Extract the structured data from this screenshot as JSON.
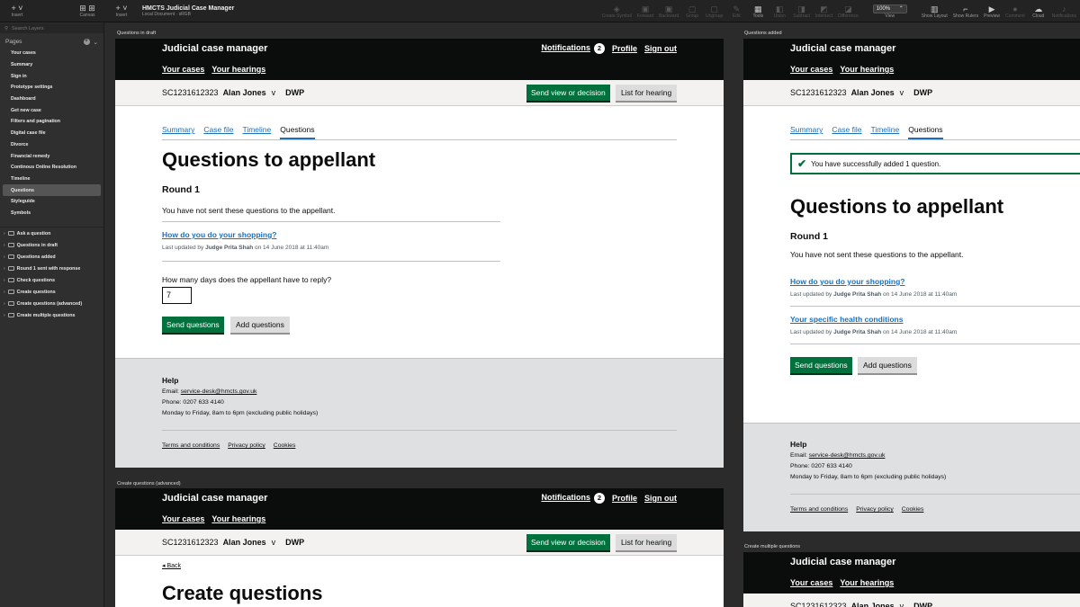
{
  "toolbar": {
    "insert": "Insert",
    "canvas": "Canvas",
    "doc_title": "HMCTS Judicial Case Manager",
    "doc_sub": "Local Document · sRGB",
    "tools": [
      "Create Symbol",
      "Forward",
      "Backward",
      "Group",
      "Ungroup",
      "Edit",
      "Tools",
      "Union",
      "Subtract",
      "Intersect",
      "Difference"
    ],
    "zoom": "100%",
    "zoom_label": "View",
    "right": [
      "Show Layout",
      "Show Rulers",
      "Preview",
      "Comment",
      "Cloud",
      "Notifications"
    ]
  },
  "sidebar": {
    "search_placeholder": "Search Layers",
    "pages_label": "Pages",
    "pages": [
      "Your cases",
      "Summary",
      "Sign in",
      "Prototype settings",
      "Dashboard",
      "Get new case",
      "Filters and pagination",
      "Digital case file",
      "Divorce",
      "Financial remedy",
      "Continous Online Resolution",
      "Timeline",
      "Questions",
      "Styleguide",
      "Symbols"
    ],
    "selected_page": "Questions",
    "layers": [
      "Ask a question",
      "Questions in draft",
      "Questions added",
      "Round 1 sent with response",
      "Check questions",
      "Create questions",
      "Create questions (advanced)",
      "Create multiple questions"
    ]
  },
  "service": {
    "name": "Judicial case manager",
    "notifications": "Notifications",
    "notif_count": "2",
    "profile": "Profile",
    "sign_out": "Sign out",
    "your_cases": "Your cases",
    "your_hearings": "Your hearings",
    "case_ref": "SC1231612323",
    "party1": "Alan Jones",
    "vs": "v",
    "party2": "DWP",
    "send_view": "Send view or decision",
    "list_hearing": "List for hearing",
    "tabs": [
      "Summary",
      "Case file",
      "Timeline",
      "Questions"
    ],
    "current_tab": "Questions"
  },
  "artboards": {
    "a1_label": "Questions in draft",
    "a2_label": "Questions added",
    "a3_label": "Create questions (advanced)",
    "a4_label": "Create multiple questions"
  },
  "page": {
    "h1": "Questions to appellant",
    "round": "Round 1",
    "not_sent": "You have not sent these questions to the appellant.",
    "q1": "How do you do your shopping?",
    "q2": "Your specific health conditions",
    "updated_prefix": "Last updated by",
    "judge": "Judge Prita Shah",
    "updated_suffix": "on 14 June 2018 at 11:40am",
    "days_label": "How many days does the appellant have to reply?",
    "days_value": "7",
    "send_questions": "Send questions",
    "add_questions": "Add questions",
    "success": "You have successfully added 1 question.",
    "back": "Back",
    "create_h1": "Create questions"
  },
  "footer": {
    "help": "Help",
    "email_prefix": "Email:",
    "email": "service-desk@hmcts.gov.uk",
    "phone": "Phone: 0207 633 4140",
    "hours": "Monday to Friday, 8am to 6pm (excluding public holidays)",
    "links": [
      "Terms and conditions",
      "Privacy policy",
      "Cookies"
    ]
  }
}
